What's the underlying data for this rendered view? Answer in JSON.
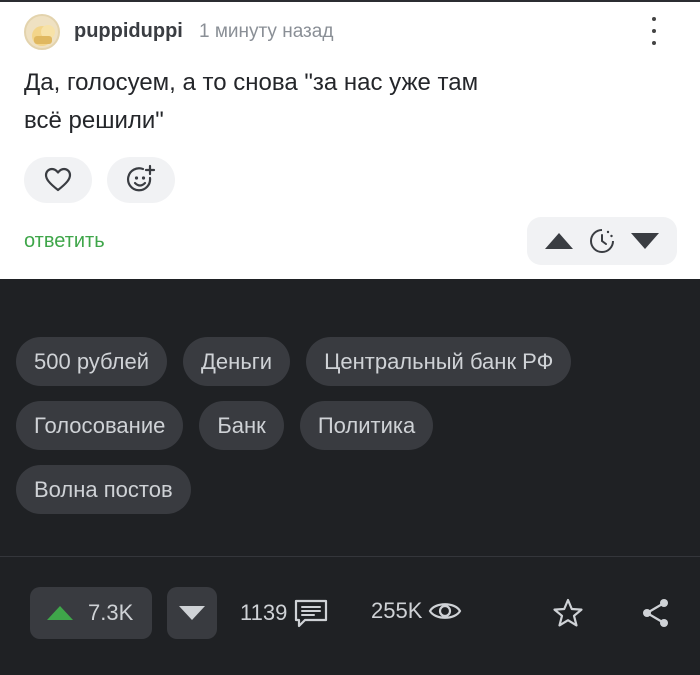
{
  "comment": {
    "author": "puppiduppi",
    "time": "1 минуту назад",
    "text_line1": "Да, голосуем, а то снова \"за нас уже там",
    "text_line2": "всё решили\"",
    "reply_label": "ответить"
  },
  "tags": [
    [
      "500 рублей",
      "Деньги",
      "Центральный банк РФ"
    ],
    [
      "Голосование",
      "Банк",
      "Политика"
    ],
    [
      "Волна постов"
    ]
  ],
  "post_actions": {
    "rating": "7.3K",
    "comments_count": "1139",
    "views": "255K"
  },
  "colors": {
    "accent_green": "#3fa64a",
    "dark_bg": "#1f2124",
    "chip_bg": "#393b40",
    "upvote_green": "#3fa64a"
  },
  "icons": [
    "avatar",
    "more-vertical-icon",
    "heart-icon",
    "add-emoji-icon",
    "arrow-up-icon",
    "clock-icon",
    "arrow-down-icon",
    "comment-icon",
    "eye-icon",
    "star-icon",
    "share-icon"
  ]
}
